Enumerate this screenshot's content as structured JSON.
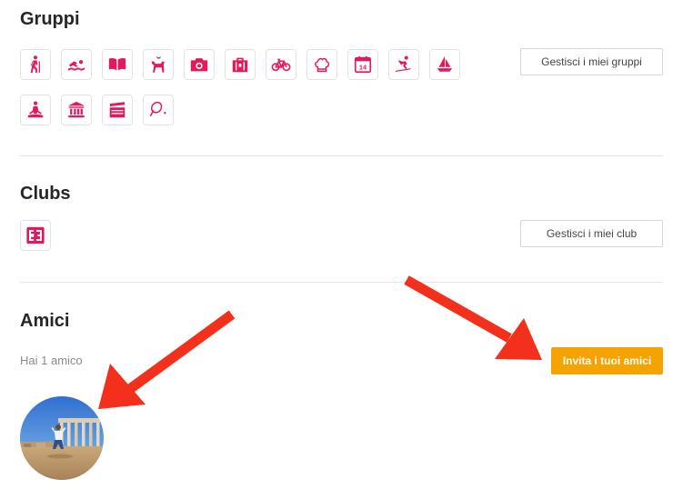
{
  "groups": {
    "title": "Gruppi",
    "manage_label": "Gestisci i miei gruppi",
    "icons": [
      "hiking-icon",
      "swimming-icon",
      "book-icon",
      "dog-icon",
      "camera-icon",
      "luggage-icon",
      "bicycle-icon",
      "chef-hat-icon",
      "calendar-icon",
      "skiing-icon",
      "sailboat-icon",
      "yoga-icon",
      "museum-icon",
      "clapperboard-icon",
      "tennis-icon"
    ],
    "calendar_day": "14"
  },
  "clubs": {
    "title": "Clubs",
    "manage_label": "Gestisci i miei club",
    "logo_icon": "club-logo-icon"
  },
  "friends": {
    "title": "Amici",
    "count_text": "Hai 1 amico",
    "invite_label": "Invita i tuoi amici"
  },
  "colors": {
    "accent": "#e2195b",
    "button_orange": "#f5a300",
    "arrow_red": "#f2301b"
  }
}
